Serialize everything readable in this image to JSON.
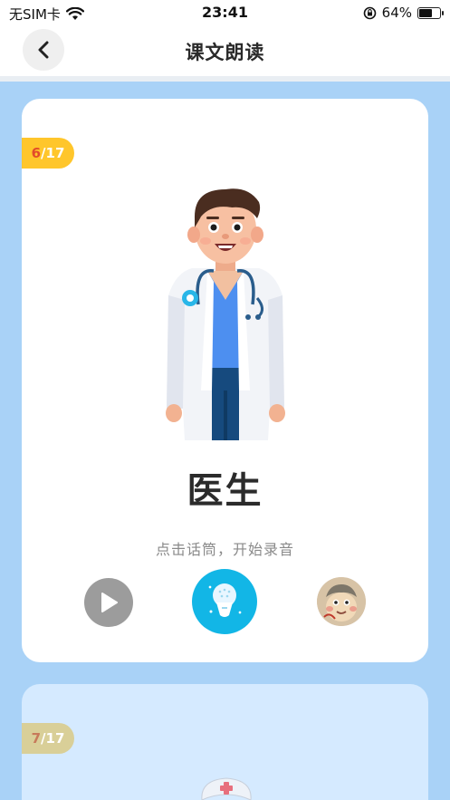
{
  "status_bar": {
    "carrier": "无SIM卡",
    "time": "23:41",
    "battery_percent": "64%",
    "battery_level": 0.64
  },
  "nav": {
    "title": "课文朗读",
    "back_icon": "chevron-left-icon"
  },
  "cards": [
    {
      "page_current": "6",
      "page_sep": "/",
      "page_total": "17",
      "word": "医生",
      "hint": "点击话筒，开始录音",
      "illustration": "doctor",
      "controls": [
        "play-icon",
        "microphone-icon",
        "avatar"
      ]
    },
    {
      "page_current": "7",
      "page_sep": "/",
      "page_total": "17",
      "illustration": "nurse"
    }
  ],
  "colors": {
    "background": "#a9d2f7",
    "badge_active": "#ffc62b",
    "badge_inactive": "#d9cf98",
    "mic_button": "#12b6e6",
    "play_button": "#9c9c9c"
  }
}
